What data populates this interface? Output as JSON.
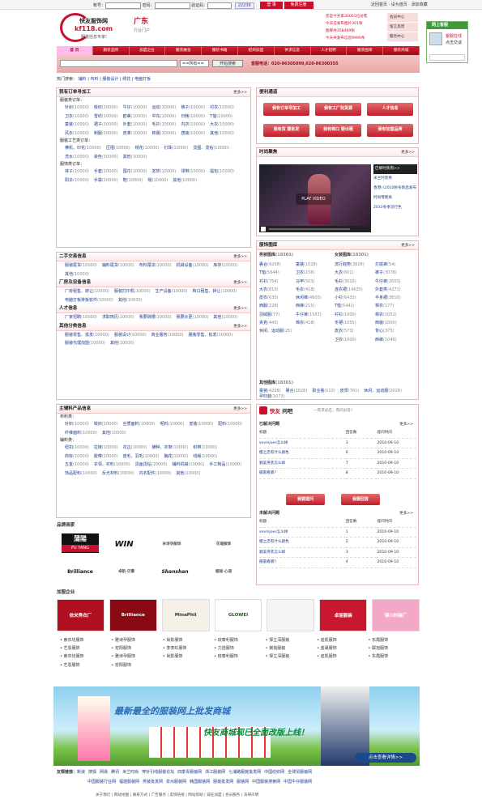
{
  "topbar": {
    "acct": "帐号：",
    "pwd": "密码：",
    "code": "验证码：",
    "captcha": "22236",
    "login": "登 录",
    "register": "免费注册",
    "links": [
      "近回首页",
      "设为首页",
      "添加收藏"
    ]
  },
  "header": {
    "logo_main": "快友服饰网",
    "logo_sub": "kf118.com",
    "logo_region": "广东",
    "logo_region2": "行业门户",
    "slogan": "服装信息专家!",
    "stats": [
      "您是今天第30001位访客",
      "今天已发布图片301张",
      "图库共358469张",
      "今天共发布信息9999条"
    ],
    "side_links": [
      "会员中心",
      "留言反馈",
      "服务中心"
    ]
  },
  "nav": {
    "items": [
      "首 页",
      "服装品牌",
      "加盟企业",
      "服装展会",
      "服装书籍",
      "招商加盟",
      "供求信息",
      "人才招聘",
      "服装图库",
      "服装商城"
    ]
  },
  "search": {
    "select": "==所有==",
    "button": "开始搜索",
    "phone": "客服电话：020-96305099,020-86300355"
  },
  "hot": {
    "label": "热门搜索：",
    "items": [
      "辅料",
      "布料",
      "服装设计",
      "绣花",
      "电脑打板"
    ]
  },
  "online": {
    "title": "网上客服",
    "status": "客服在线",
    "action": "点击交谈"
  },
  "orders": {
    "title": "我有订单寻加工",
    "more": "更多>>",
    "groups": [
      {
        "name": "服装类订单：",
        "items": [
          [
            "针织",
            "10000"
          ],
          [
            "梭织",
            "10000"
          ],
          [
            "牛仔",
            "10000"
          ],
          [
            "运动",
            "10000"
          ],
          [
            "裤子",
            "10000"
          ],
          [
            "衬衣",
            "10000"
          ],
          [
            "卫衣",
            "10000"
          ],
          [
            "雪纺",
            "10000"
          ],
          [
            "欧美",
            "10000"
          ],
          [
            "中东",
            "10000"
          ],
          [
            "日韩",
            "10000"
          ],
          [
            "T恤",
            "10000"
          ],
          [
            "童装",
            "10000"
          ],
          [
            "裙子",
            "10000"
          ],
          [
            "外套",
            "10000"
          ],
          [
            "毛衫",
            "10000"
          ],
          [
            "内衣",
            "10000"
          ],
          [
            "大衣",
            "10000"
          ],
          [
            "风衣",
            "10000"
          ],
          [
            "制服",
            "10000"
          ],
          [
            "皮革",
            "10000"
          ],
          [
            "棉服",
            "10000"
          ],
          [
            "唐装",
            "10000"
          ],
          [
            "其他",
            "10000"
          ]
        ]
      },
      {
        "name": "服装工艺类订单：",
        "items": [
          [
            "横机、印花",
            "10000"
          ],
          [
            "压褶",
            "10000"
          ],
          [
            "绣花",
            "10000"
          ],
          [
            "钉珠",
            "10000"
          ],
          [
            "烫图、烫钻",
            "10000"
          ],
          [
            "洗水",
            "10000"
          ],
          [
            "染色",
            "10000"
          ],
          [
            "其他",
            "10000"
          ]
        ]
      },
      {
        "name": "服饰类订单：",
        "items": [
          [
            "袜子",
            "10000"
          ],
          [
            "手套",
            "10000"
          ],
          [
            "围巾",
            "10000"
          ],
          [
            "发饰",
            "10000"
          ],
          [
            "领带",
            "10000"
          ],
          [
            "提包",
            "10000"
          ],
          [
            "阳伞",
            "10000"
          ],
          [
            "手袋",
            "10000"
          ],
          [
            "鞋",
            "10000"
          ],
          [
            "帽",
            "10000"
          ],
          [
            "其他",
            "10000"
          ]
        ]
      }
    ]
  },
  "convenience": {
    "title": "便利通道",
    "buttons": [
      "我有订单寻加工",
      "我有工厂找货源",
      "人才信息",
      "我有货 要批发",
      "我有档口 要出租",
      "我有加盟品牌"
    ]
  },
  "fashion": {
    "title": "时尚聚焦",
    "more": "更多>>",
    "play": "PLAY VIDEO",
    "captions": [
      "巴黎时装周>>",
      "米兰时装秀",
      "香港八2010秋冬新品发布",
      "时尚零距离",
      "2010冬季流行色"
    ]
  },
  "secondhand": {
    "title": "二手交易信息",
    "more": "更多>>",
    "items": [
      [
        "服装尾货",
        "10000"
      ],
      [
        "辅料尾货",
        "10000"
      ],
      [
        "布料尾货",
        "10000"
      ],
      [
        "机械设备",
        "10000"
      ],
      [
        "库存",
        "10000"
      ],
      [
        "其他",
        "10000"
      ]
    ]
  },
  "factory": {
    "title": "厂房及设备信息",
    "more": "更多>>",
    "items": [
      [
        "厂房租售、转让",
        "10000"
      ],
      [
        "服装打印机",
        "10000"
      ],
      [
        "生产设备",
        "10000"
      ],
      [
        "档口租售、转让",
        "10000"
      ],
      [
        "电脑打板排板软件",
        "10000"
      ],
      [
        "其他",
        "10000"
      ]
    ]
  },
  "talent": {
    "title": "人才信息",
    "more": "更多>>",
    "items": [
      [
        "厂家招聘",
        "10000"
      ],
      [
        "求职简历",
        "10000"
      ],
      [
        "我要跳槽",
        "10000"
      ],
      [
        "我要炒更",
        "10000"
      ],
      [
        "其他",
        "10000"
      ]
    ]
  },
  "others": {
    "title": "其他分类信息",
    "more": "更多>>",
    "items": [
      [
        "服装零售、批发",
        "10000"
      ],
      [
        "服装设计",
        "10000"
      ],
      [
        "商业服务",
        "10000"
      ],
      [
        "服装零售、批发",
        "10000"
      ],
      [
        "服装代理加盟",
        "10000"
      ],
      [
        "其他",
        "10000"
      ]
    ]
  },
  "gallery": {
    "title": "服饰图库",
    "more": "更多>>",
    "male_title": "男装图库",
    "male_count": "(18301)",
    "female_title": "女装图库",
    "female_count": "(18301)",
    "male": [
      [
        "裹合",
        "4208"
      ],
      [
        "童装",
        "1028"
      ],
      [
        "T恤",
        "5644"
      ],
      [
        "卫衣",
        "156"
      ],
      [
        "衬衫",
        "754"
      ],
      [
        "马甲",
        "503"
      ],
      [
        "大衣",
        "810"
      ],
      [
        "毛衣",
        "418"
      ],
      [
        "皮衣",
        "630"
      ],
      [
        "休闲裤",
        "4603"
      ],
      [
        "西服",
        "228"
      ],
      [
        "西裤",
        "215"
      ],
      [
        "羽绒服",
        "77"
      ],
      [
        "牛仔裤",
        "1557"
      ],
      [
        "夹克",
        "440"
      ],
      [
        "棉衣",
        "418"
      ],
      [
        "休闲、运动服",
        "25"
      ]
    ],
    "female": [
      [
        "流行趋势",
        "3828"
      ],
      [
        "打底裤",
        "54"
      ],
      [
        "大衣",
        "601"
      ],
      [
        "裤子",
        "3078"
      ],
      [
        "毛衫",
        "3010"
      ],
      [
        "牛仔裤",
        "2003"
      ],
      [
        "连衣裙",
        "14635"
      ],
      [
        "外套类",
        "4271"
      ],
      [
        "小衫",
        "6433"
      ],
      [
        "半身裙",
        "3810"
      ],
      [
        "T恤",
        "5441"
      ],
      [
        "棉衣",
        "177"
      ],
      [
        "衬衫",
        "1000"
      ],
      [
        "棉衣",
        "1052"
      ],
      [
        "冬裙",
        "1055"
      ],
      [
        "西装",
        "1000"
      ],
      [
        "皮衣",
        "573"
      ],
      [
        "背心",
        "373"
      ],
      [
        "卫衣",
        "1000"
      ],
      [
        "西裤",
        "1046"
      ]
    ],
    "other_title": "其他图库",
    "other_count": "(18301)",
    "other": [
      [
        "童装",
        "4208"
      ],
      [
        "裹合",
        "2026"
      ],
      [
        "职业装",
        "113"
      ],
      [
        "皮草",
        "761"
      ],
      [
        "休闲、运动服",
        "2028"
      ],
      [
        "孕妇装",
        "1073"
      ]
    ]
  },
  "mainprod": {
    "title": "主辅料产品信息",
    "more": "更多>>",
    "fabric": "布料类：",
    "fabric_items": [
      [
        "针织",
        "10000"
      ],
      [
        "梭织",
        "10000"
      ],
      [
        "丝质面料",
        "10000"
      ],
      [
        "呢料",
        "10000"
      ],
      [
        "皮装",
        "10000"
      ],
      [
        "配料",
        "10000"
      ],
      [
        "纤维面料",
        "10000"
      ],
      [
        "其他",
        "10000"
      ]
    ],
    "acc": "辅料类：",
    "acc_items": [
      [
        "纽扣",
        "10000"
      ],
      [
        "拉链",
        "10000"
      ],
      [
        "花边",
        "10000"
      ],
      [
        "横种、衣架",
        "10000"
      ],
      [
        "织带",
        "10000"
      ],
      [
        "商标",
        "10000"
      ],
      [
        "胶带",
        "10000"
      ],
      [
        "皮毛、羽毛",
        "10000"
      ],
      [
        "胸花",
        "10000"
      ],
      [
        "线绳",
        "10000"
      ],
      [
        "五金",
        "10000"
      ],
      [
        "衣领、衬料",
        "10000"
      ],
      [
        "烫画烫钻",
        "10000"
      ],
      [
        "辅料机械",
        "10000"
      ],
      [
        "手工制品",
        "10000"
      ],
      [
        "饰品配料",
        "10000"
      ],
      [
        "反光材料",
        "10000"
      ],
      [
        "内衣配件",
        "10000"
      ],
      [
        "其他",
        "10000"
      ]
    ]
  },
  "qa": {
    "brand": "快友",
    "brand2": "问吧",
    "tagline": "一有求必应，有问必答！",
    "solved_title": "已解决问题",
    "more": "更多>>",
    "cols": [
      "标题",
      "回答数",
      "提问时间"
    ],
    "solved": [
      [
        "sevmjoes怎么样",
        "3",
        "2010-09-10"
      ],
      [
        "樱之恋有什么颜色",
        "6",
        "2010-09-10"
      ],
      [
        "顺美男装怎么样",
        "7",
        "2010-09-10"
      ],
      [
        "擂雷看裘?",
        "8",
        "2010-09-10"
      ]
    ],
    "ask": "我要提问",
    "answer": "我要回答",
    "unsolved_title": "未解决问题",
    "unsolved": [
      [
        "sevmjoes怎么样",
        "1",
        "2010-09-10"
      ],
      [
        "樱之恋有什么颜色",
        "2",
        "2010-09-10"
      ],
      [
        "顺美男装怎么样",
        "3",
        "2010-09-10"
      ],
      [
        "擂雷看裘?",
        "4",
        "2010-09-10"
      ]
    ]
  },
  "brands": {
    "title": "品牌商家",
    "logos": [
      "蒲陽",
      "PU YANG",
      "WIN",
      "米诗孕服饰",
      "花瑞服饰",
      "Brilliance",
      "卓航·贝雷",
      "Shanshan",
      "蜡丽·心语"
    ]
  },
  "join": {
    "title": "加盟企业",
    "banners": [
      "依米秀衣厂",
      "Brilliance",
      "MinaPhil",
      "GLOWEI",
      "",
      "卓丽服装",
      "锦川时装厂"
    ],
    "cols": [
      [
        "索衣坊服饰",
        "艺恩服饰",
        "索衣坊服饰",
        "艺恩服饰"
      ],
      [
        "雅诗孕服饰",
        "宏阳服饰",
        "雅诗孕服饰",
        "宏阳服饰"
      ],
      [
        "尚影服饰",
        "李李红服饰",
        "尚影服饰"
      ],
      [
        "琉泰利服饰",
        "力选服饰",
        "琉泰利服饰"
      ],
      [
        "择立深服装",
        "裳铭服装",
        "择立深服装"
      ],
      [
        "迪凯服饰",
        "金晟服饰",
        "迪凯服饰"
      ],
      [
        "东霞服饰",
        "联旭服饰",
        "东霞服饰"
      ]
    ]
  },
  "banner": {
    "line1": "最新最全的服装网上批发商城",
    "line2": "快友商城现已全面改版上线！",
    "cta": "点击查看详情>>"
  },
  "friends": {
    "title": "友情链接：",
    "row1": [
      "新浪",
      "搜狐",
      "网易",
      "腾讯",
      "米兰时尚",
      "穿针引线服装论坛",
      "四季青服装网",
      "浙江服装网",
      "七浦路服装批发网",
      "中国纺织网",
      "全球贸服装网"
    ],
    "row2": [
      "中国服装行业网",
      "福建服装网",
      "男装批发网",
      "泉州服装网",
      "韩国服装网",
      "服装批发网",
      "服装网",
      "中国服装搜索网",
      "中国牛仔服装网"
    ]
  },
  "footer": {
    "links": [
      "关于我们",
      "网站地图",
      "联系方式",
      "广告服务",
      "友情链接",
      "网站帮助",
      "诚征加盟",
      "会员服务",
      "法律声明"
    ]
  }
}
